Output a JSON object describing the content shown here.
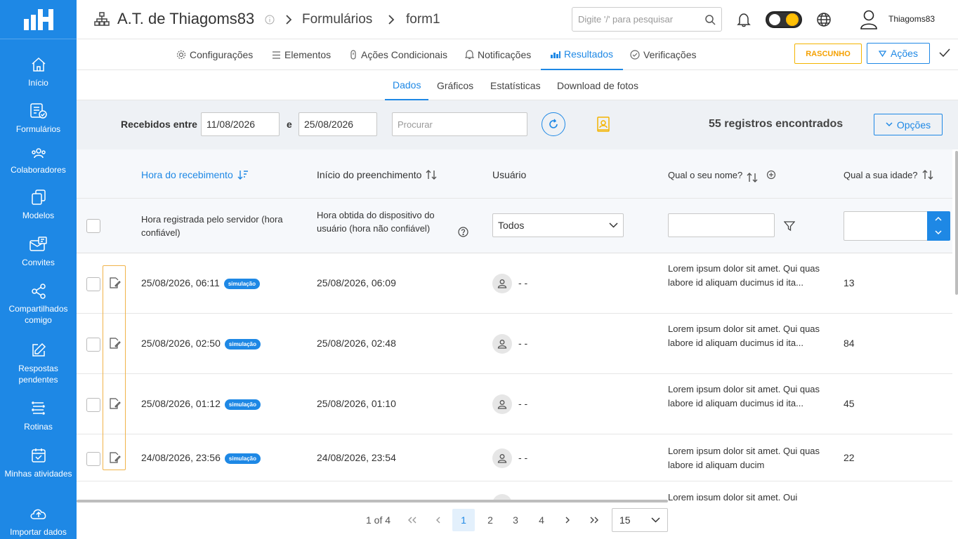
{
  "sidebar": {
    "items": [
      {
        "label": "Início",
        "icon": "home-icon"
      },
      {
        "label": "Formulários",
        "icon": "forms-icon"
      },
      {
        "label": "Colaboradores",
        "icon": "collaborators-icon"
      },
      {
        "label": "Modelos",
        "icon": "templates-icon"
      },
      {
        "label": "Convites",
        "icon": "invites-icon"
      },
      {
        "label": "Compartilhados comigo",
        "icon": "share-icon"
      },
      {
        "label": "Respostas pendentes",
        "icon": "edit-icon"
      },
      {
        "label": "Rotinas",
        "icon": "routines-icon"
      },
      {
        "label": "Minhas atividades",
        "icon": "calendar-check-icon"
      },
      {
        "label": "Importar dados",
        "icon": "cloud-upload-icon"
      }
    ]
  },
  "header": {
    "org": "A.T. de Thiagoms83",
    "crumb1": "Formulários",
    "crumb2": "form1",
    "search_placeholder": "Digite '/' para pesquisar",
    "username": "Thiagoms83"
  },
  "tabs": {
    "items": [
      "Configurações",
      "Elementos",
      "Ações Condicionais",
      "Notificações",
      "Resultados",
      "Verificações"
    ],
    "draft": "RASCUNHO",
    "actions": "Ações"
  },
  "subtabs": [
    "Dados",
    "Gráficos",
    "Estatísticas",
    "Download de fotos"
  ],
  "filters": {
    "received_between": "Recebidos entre",
    "date_from": "11/08/2026",
    "and": "e",
    "date_to": "25/08/2026",
    "search_placeholder": "Procurar",
    "records": "55 registros encontrados",
    "options": "Opções"
  },
  "table": {
    "headers": [
      "Hora do recebimento",
      "Início do preenchimento",
      "Usuário",
      "Qual o seu nome?",
      "Qual a sua idade?"
    ],
    "desc_received": "Hora registrada pelo servidor (hora confiável)",
    "desc_start": "Hora obtida do dispositivo do usuário (hora não confiável)",
    "user_filter": "Todos",
    "rows": [
      {
        "received": "25/08/2026, 06:11",
        "badge": "simulação",
        "start": "25/08/2026, 06:09",
        "user": "- -",
        "name": "Lorem ipsum dolor sit amet. Qui quas labore id aliquam ducimus id ita...",
        "age": "13"
      },
      {
        "received": "25/08/2026, 02:50",
        "badge": "simulação",
        "start": "25/08/2026, 02:48",
        "user": "- -",
        "name": "Lorem ipsum dolor sit amet. Qui quas labore id aliquam ducimus id ita...",
        "age": "84"
      },
      {
        "received": "25/08/2026, 01:12",
        "badge": "simulação",
        "start": "25/08/2026, 01:10",
        "user": "- -",
        "name": "Lorem ipsum dolor sit amet. Qui quas labore id aliquam ducimus id ita...",
        "age": "45"
      },
      {
        "received": "24/08/2026, 23:56",
        "badge": "simulação",
        "start": "24/08/2026, 23:54",
        "user": "- -",
        "name": "Lorem ipsum dolor sit amet. Qui quas labore id aliquam ducim",
        "age": "22"
      }
    ],
    "peek_text": "Lorem ipsum dolor sit amet. Qui"
  },
  "pagination": {
    "summary": "1 of 4",
    "pages": [
      "1",
      "2",
      "3",
      "4"
    ],
    "page_size": "15"
  },
  "colors": {
    "primary": "#1e88e5",
    "draft": "#f4b400"
  }
}
